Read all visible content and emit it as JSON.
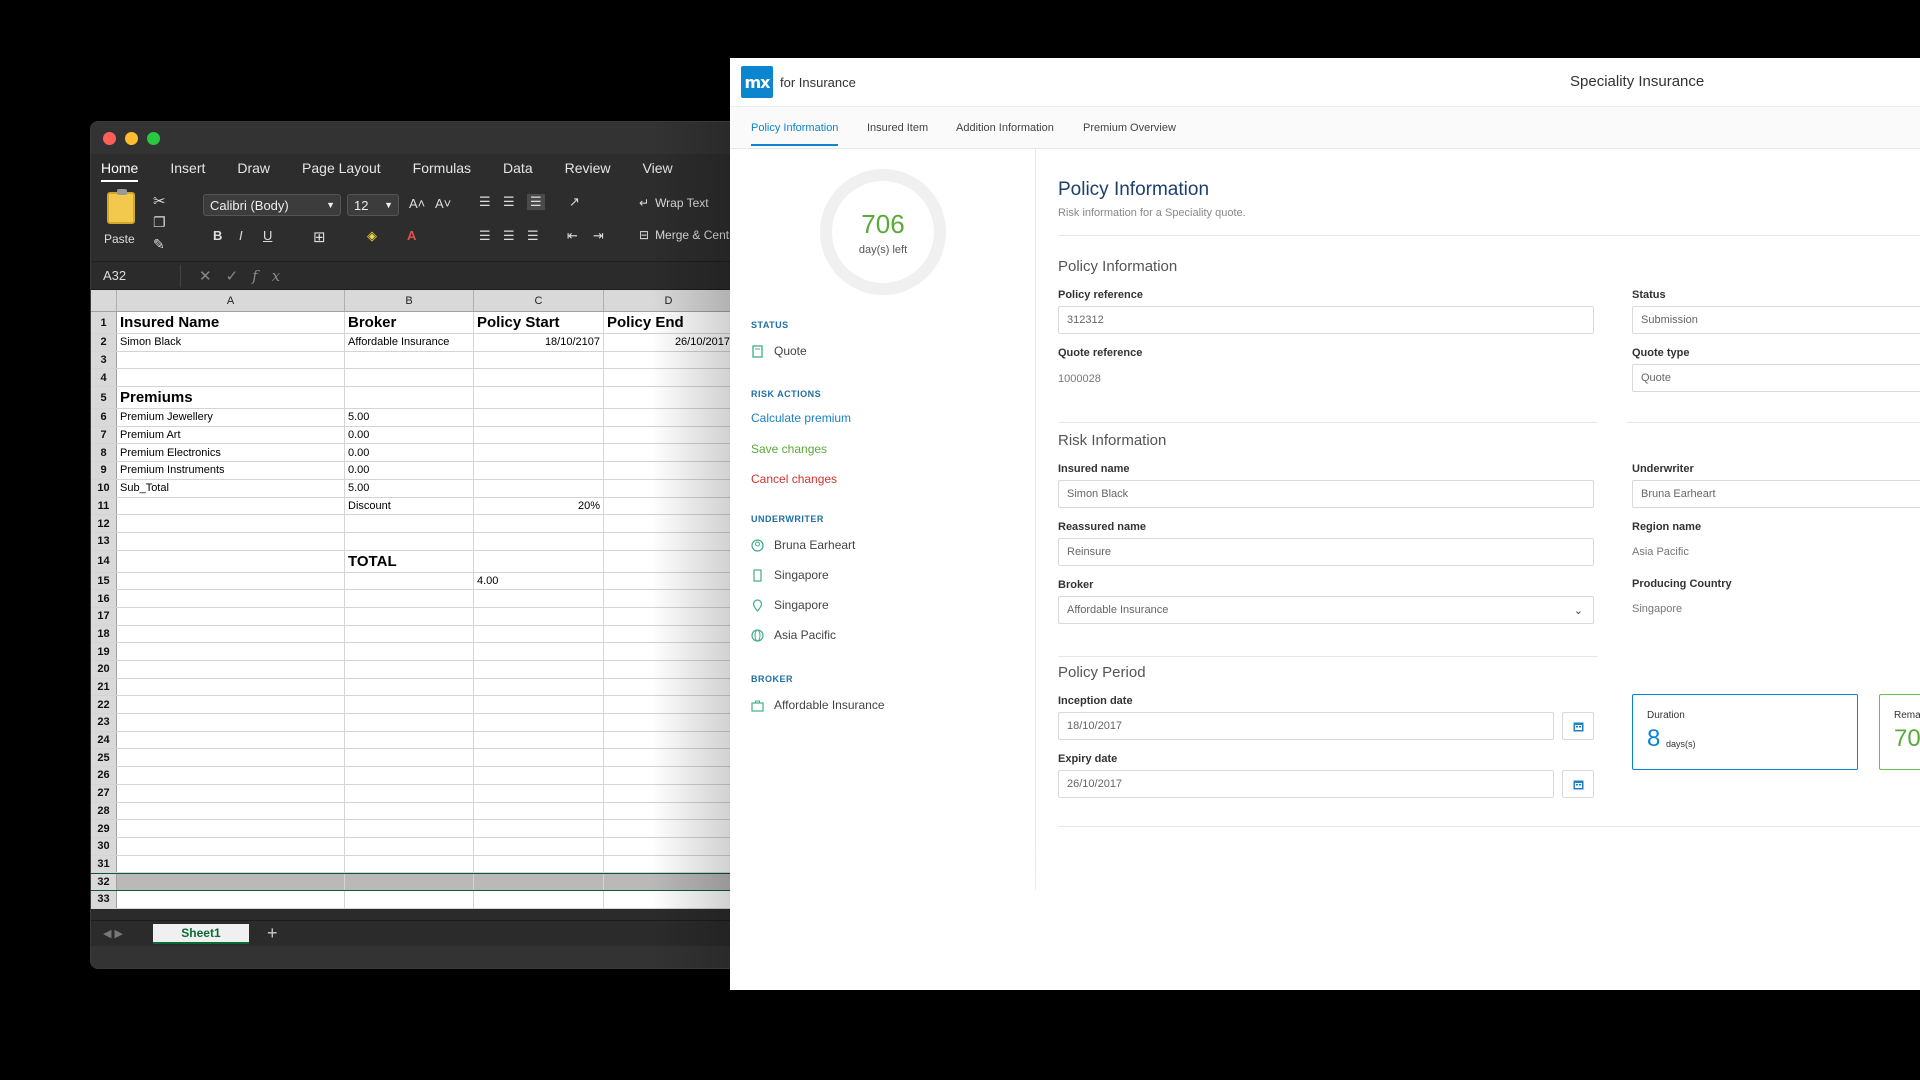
{
  "excel": {
    "tabs": [
      "Home",
      "Insert",
      "Draw",
      "Page Layout",
      "Formulas",
      "Data",
      "Review",
      "View"
    ],
    "paste_label": "Paste",
    "font_name": "Calibri (Body)",
    "font_size": "12",
    "wrap_text": "Wrap Text",
    "merge": "Merge & Centre",
    "name_box": "A32",
    "columns": [
      "A",
      "B",
      "C",
      "D"
    ],
    "rows": [
      {
        "n": "1",
        "a": "Insured Name",
        "b": "Broker",
        "c": "Policy Start",
        "d": "Policy End",
        "big": true
      },
      {
        "n": "2",
        "a": "Simon Black",
        "b": "Affordable Insurance",
        "c": "18/10/2107",
        "d": "26/10/2017"
      },
      {
        "n": "3",
        "a": "",
        "b": "",
        "c": "",
        "d": ""
      },
      {
        "n": "4",
        "a": "",
        "b": "",
        "c": "",
        "d": ""
      },
      {
        "n": "5",
        "a": "Premiums",
        "b": "",
        "c": "",
        "d": "",
        "big": true
      },
      {
        "n": "6",
        "a": "Premium Jewellery",
        "b": "5.00",
        "c": "",
        "d": ""
      },
      {
        "n": "7",
        "a": "Premium Art",
        "b": "0.00",
        "c": "",
        "d": ""
      },
      {
        "n": "8",
        "a": "Premium Electronics",
        "b": "0.00",
        "c": "",
        "d": ""
      },
      {
        "n": "9",
        "a": "Premium Instruments",
        "b": "0.00",
        "c": "",
        "d": ""
      },
      {
        "n": "10",
        "a": "Sub_Total",
        "b": "5.00",
        "c": "",
        "d": ""
      },
      {
        "n": "11",
        "a": "",
        "b": "Discount",
        "c": "20%",
        "d": ""
      },
      {
        "n": "12",
        "a": "",
        "b": "",
        "c": "",
        "d": ""
      },
      {
        "n": "13",
        "a": "",
        "b": "",
        "c": "",
        "d": ""
      },
      {
        "n": "14",
        "a": "",
        "b": "TOTAL",
        "c": "",
        "d": "",
        "bigb": true
      },
      {
        "n": "15",
        "a": "",
        "b": "",
        "c": "4.00",
        "d": ""
      },
      {
        "n": "16",
        "a": "",
        "b": "",
        "c": "",
        "d": ""
      },
      {
        "n": "17",
        "a": "",
        "b": "",
        "c": "",
        "d": ""
      },
      {
        "n": "18",
        "a": "",
        "b": "",
        "c": "",
        "d": ""
      },
      {
        "n": "19",
        "a": "",
        "b": "",
        "c": "",
        "d": ""
      },
      {
        "n": "20",
        "a": "",
        "b": "",
        "c": "",
        "d": ""
      },
      {
        "n": "21",
        "a": "",
        "b": "",
        "c": "",
        "d": ""
      },
      {
        "n": "22",
        "a": "",
        "b": "",
        "c": "",
        "d": ""
      },
      {
        "n": "23",
        "a": "",
        "b": "",
        "c": "",
        "d": ""
      },
      {
        "n": "24",
        "a": "",
        "b": "",
        "c": "",
        "d": ""
      },
      {
        "n": "25",
        "a": "",
        "b": "",
        "c": "",
        "d": ""
      },
      {
        "n": "26",
        "a": "",
        "b": "",
        "c": "",
        "d": ""
      },
      {
        "n": "27",
        "a": "",
        "b": "",
        "c": "",
        "d": ""
      },
      {
        "n": "28",
        "a": "",
        "b": "",
        "c": "",
        "d": ""
      },
      {
        "n": "29",
        "a": "",
        "b": "",
        "c": "",
        "d": ""
      },
      {
        "n": "30",
        "a": "",
        "b": "",
        "c": "",
        "d": ""
      },
      {
        "n": "31",
        "a": "",
        "b": "",
        "c": "",
        "d": ""
      },
      {
        "n": "32",
        "a": "",
        "b": "",
        "c": "",
        "d": "",
        "sel": true
      },
      {
        "n": "33",
        "a": "",
        "b": "",
        "c": "",
        "d": ""
      }
    ],
    "sheet": "Sheet1",
    "add_sheet": "+"
  },
  "app": {
    "logo": "mx",
    "brand": "for Insurance",
    "title": "Speciality Insurance",
    "tabs": [
      "Policy Information",
      "Insured Item",
      "Addition Information",
      "Premium Overview"
    ],
    "days_left": {
      "value": "706",
      "label": "day(s) left"
    },
    "sidebar": {
      "status_head": "STATUS",
      "status": "Quote",
      "risk_head": "RISK ACTIONS",
      "calc": "Calculate premium",
      "save": "Save changes",
      "cancel": "Cancel changes",
      "uw_head": "UNDERWRITER",
      "uw_name": "Bruna Earheart",
      "uw_office": "Singapore",
      "uw_country": "Singapore",
      "uw_region": "Asia Pacific",
      "broker_head": "BROKER",
      "broker": "Affordable Insurance"
    },
    "main": {
      "title": "Policy Information",
      "subtitle": "Risk information for a Speciality quote.",
      "sec_policy": "Policy Information",
      "policy_ref_lbl": "Policy reference",
      "policy_ref": "312312",
      "quote_ref_lbl": "Quote reference",
      "quote_ref": "1000028",
      "status_lbl": "Status",
      "status": "Submission",
      "quote_type_lbl": "Quote type",
      "quote_type": "Quote",
      "sec_risk": "Risk Information",
      "insured_lbl": "Insured name",
      "insured": "Simon Black",
      "reassured_lbl": "Reassured name",
      "reassured": "Reinsure",
      "broker_lbl": "Broker",
      "broker": "Affordable Insurance",
      "underwriter_lbl": "Underwriter",
      "underwriter": "Bruna Earheart",
      "region_lbl": "Region name",
      "region": "Asia Pacific",
      "country_lbl": "Producing Country",
      "country": "Singapore",
      "sec_period": "Policy Period",
      "inception_lbl": "Inception date",
      "inception": "18/10/2017",
      "expiry_lbl": "Expiry date",
      "expiry": "26/10/2017",
      "duration_lbl": "Duration",
      "duration": "8",
      "duration_unit": "days(s)",
      "remaining_lbl": "Rema",
      "remaining": "70"
    }
  }
}
